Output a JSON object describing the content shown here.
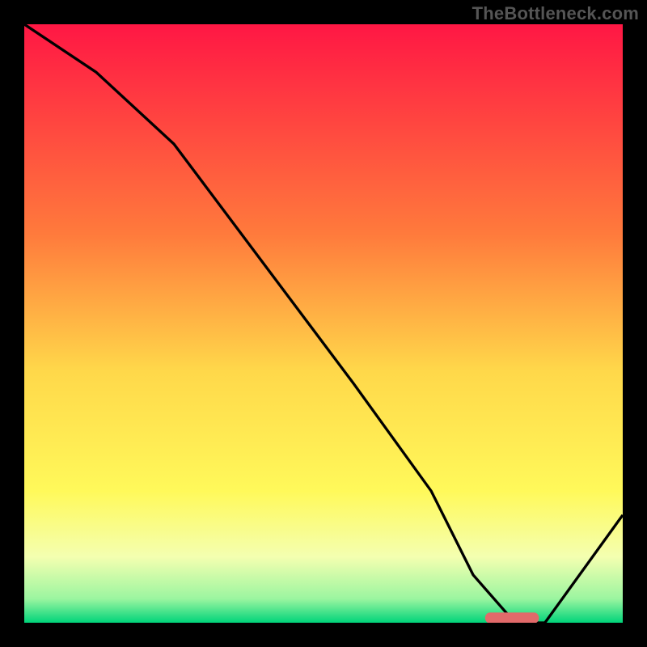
{
  "watermark": "TheBottleneck.com",
  "chart_data": {
    "type": "line",
    "title": "",
    "xlabel": "",
    "ylabel": "",
    "xlim": [
      0,
      100
    ],
    "ylim": [
      0,
      100
    ],
    "gradient_stops": [
      {
        "offset": 0,
        "color": "#ff1744"
      },
      {
        "offset": 35,
        "color": "#ff7a3c"
      },
      {
        "offset": 58,
        "color": "#ffd84a"
      },
      {
        "offset": 78,
        "color": "#fff95a"
      },
      {
        "offset": 89,
        "color": "#f4ffb0"
      },
      {
        "offset": 96,
        "color": "#9bf5a0"
      },
      {
        "offset": 100,
        "color": "#00d47a"
      }
    ],
    "series": [
      {
        "name": "bottleneck-curve",
        "x": [
          0,
          12,
          25,
          40,
          55,
          68,
          75,
          82,
          87,
          100
        ],
        "values": [
          100,
          92,
          80,
          60,
          40,
          22,
          8,
          0,
          0,
          18
        ]
      }
    ],
    "marker": {
      "name": "optimal-range",
      "x_start": 77,
      "x_end": 86,
      "y": 0.8,
      "color": "#e26a6a"
    }
  }
}
